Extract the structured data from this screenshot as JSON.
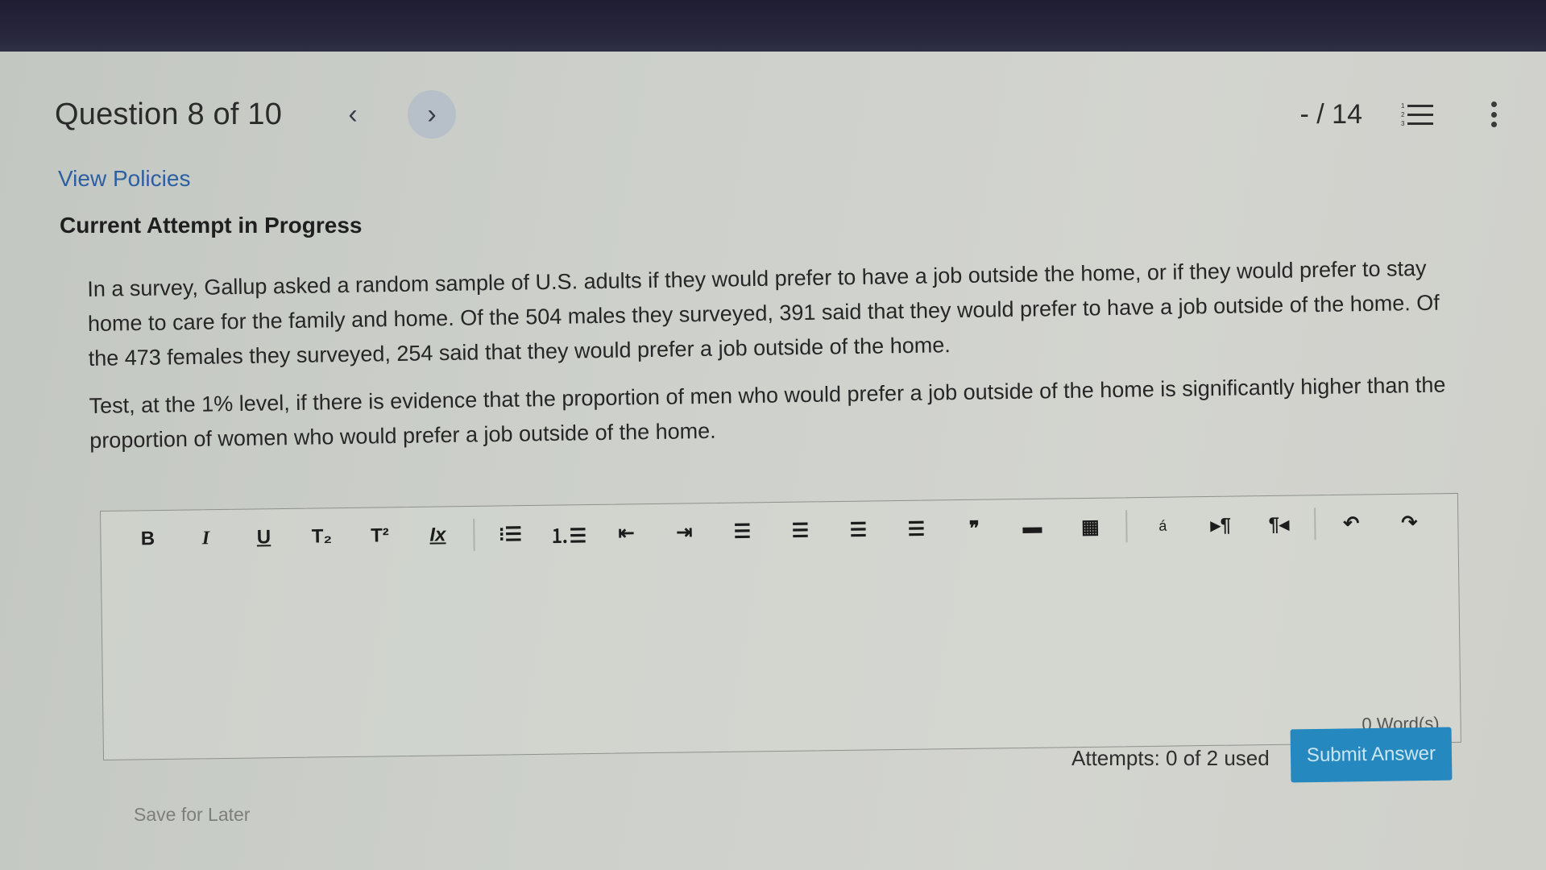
{
  "header": {
    "title": "Question 8 of 10",
    "prev_icon": "chevron-left-icon",
    "next_icon": "chevron-right-icon",
    "score": "- / 14",
    "question_list_icon": "numbered-list-icon",
    "more_icon": "kebab-menu-icon",
    "list_numbers": [
      "1",
      "2",
      "3"
    ]
  },
  "links": {
    "view_policies": "View Policies"
  },
  "attempt": {
    "title": "Current Attempt in Progress"
  },
  "question": {
    "paragraphs": [
      "In a survey, Gallup asked a random sample of U.S. adults if they would prefer to have a job outside the home, or if they would prefer to stay home to care for the family and home. Of the 504 males they surveyed, 391 said that they would prefer to have a job outside of the home. Of the 473 females they surveyed, 254 said that they would prefer a job outside of the home.",
      "Test, at the 1% level, if there is evidence that the proportion of men who would prefer a job outside of the home is significantly higher than the proportion of women who would prefer a job outside of the home."
    ]
  },
  "editor": {
    "toolbar": [
      {
        "name": "bold",
        "glyph": "B"
      },
      {
        "name": "italic",
        "glyph": "I"
      },
      {
        "name": "underline",
        "glyph": "U"
      },
      {
        "name": "subscript",
        "glyph": "T₂"
      },
      {
        "name": "superscript",
        "glyph": "T²"
      },
      {
        "name": "clear-formatting",
        "glyph": "Ix"
      },
      {
        "name": "bulleted-list",
        "glyph": "⁝☰"
      },
      {
        "name": "numbered-list",
        "glyph": "⒈☰"
      },
      {
        "name": "outdent",
        "glyph": "⇤"
      },
      {
        "name": "indent",
        "glyph": "⇥"
      },
      {
        "name": "align-left",
        "glyph": "☰"
      },
      {
        "name": "align-center",
        "glyph": "☰"
      },
      {
        "name": "align-right",
        "glyph": "☰"
      },
      {
        "name": "justify",
        "glyph": "☰"
      },
      {
        "name": "blockquote",
        "glyph": "❞"
      },
      {
        "name": "horizontal-rule",
        "glyph": "▬"
      },
      {
        "name": "table",
        "glyph": "▦"
      },
      {
        "name": "special-character",
        "glyph": "á"
      },
      {
        "name": "ltr-direction",
        "glyph": "▸¶"
      },
      {
        "name": "rtl-direction",
        "glyph": "¶◂"
      },
      {
        "name": "undo",
        "glyph": "↶"
      },
      {
        "name": "redo",
        "glyph": "↷"
      }
    ],
    "value": "",
    "word_count": "0 Word(s)"
  },
  "footer": {
    "attempts": "Attempts: 0 of 2 used",
    "submit_label": "Submit Answer",
    "save_later": "Save for Later"
  },
  "colors": {
    "link": "#2c5fa0",
    "submit_bg": "#2589bf",
    "submit_text": "#cbe6f3"
  }
}
